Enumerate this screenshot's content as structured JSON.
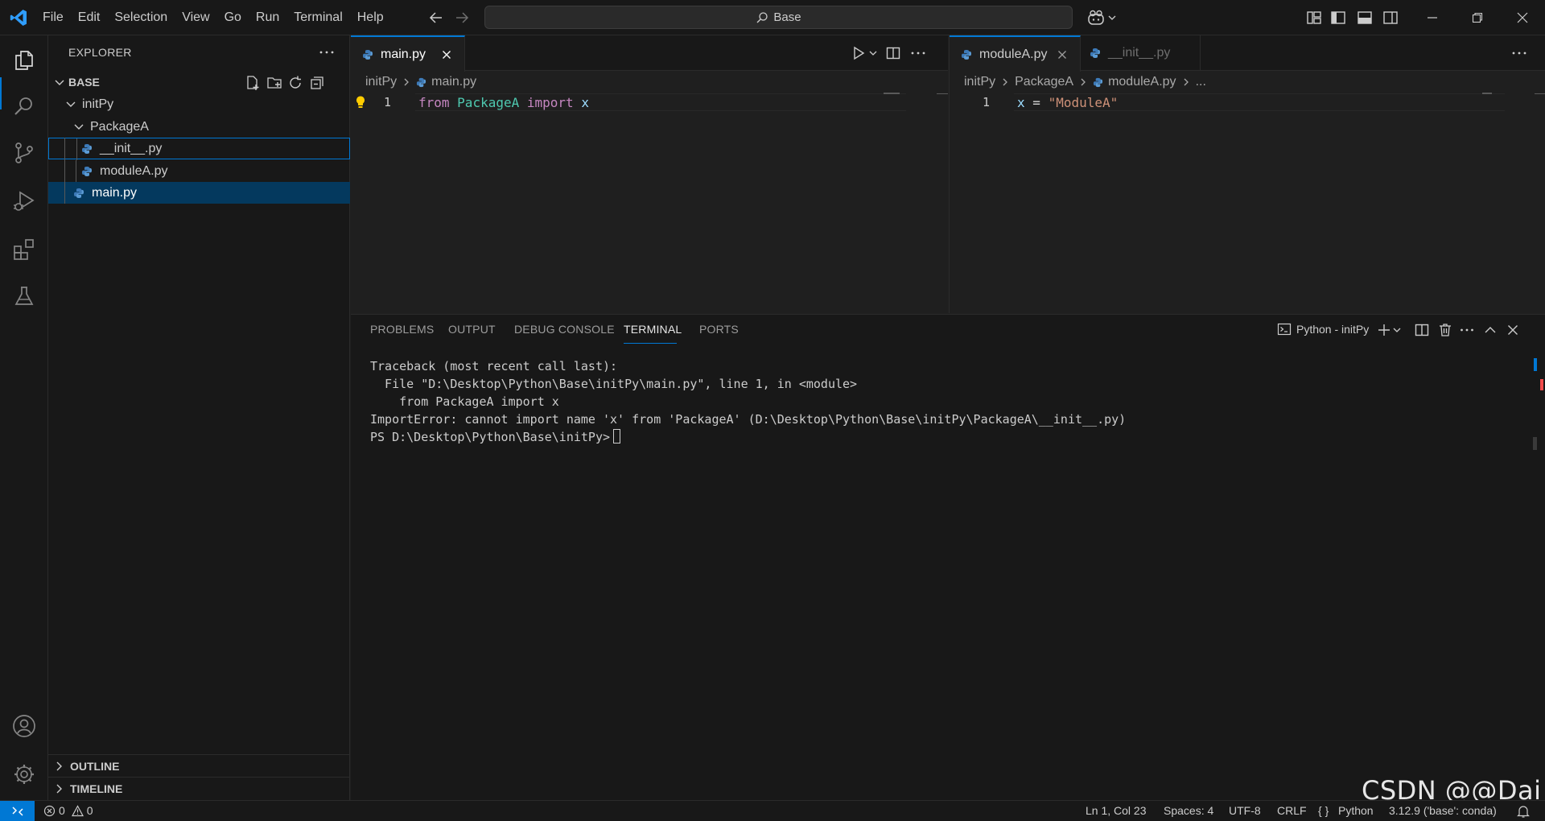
{
  "menu": [
    "File",
    "Edit",
    "Selection",
    "View",
    "Go",
    "Run",
    "Terminal",
    "Help"
  ],
  "search": {
    "text": "Base"
  },
  "sidebar": {
    "title": "EXPLORER",
    "root": "BASE",
    "tree": {
      "folder1": "initPy",
      "folder2": "PackageA",
      "file_init": "__init__.py",
      "file_moduleA": "moduleA.py",
      "file_main": "main.py"
    },
    "outline": "OUTLINE",
    "timeline": "TIMELINE"
  },
  "editor_left": {
    "tab": "main.py",
    "breadcrumbs": [
      "initPy",
      "main.py"
    ],
    "line_no": "1",
    "code": {
      "kw1": "from",
      "module": "PackageA",
      "kw2": "import",
      "name": "x"
    }
  },
  "editor_right": {
    "tabs": [
      "moduleA.py",
      "__init__.py"
    ],
    "breadcrumbs": [
      "initPy",
      "PackageA",
      "moduleA.py",
      "..."
    ],
    "line_no": "1",
    "code": {
      "var": "x",
      "op": "=",
      "str": "\"ModuleA\""
    }
  },
  "panel": {
    "tabs": [
      "PROBLEMS",
      "OUTPUT",
      "DEBUG CONSOLE",
      "TERMINAL",
      "PORTS"
    ],
    "active_tab": "TERMINAL",
    "profile": "Python - initPy",
    "terminal_lines": [
      "Traceback (most recent call last):",
      "  File \"D:\\Desktop\\Python\\Base\\initPy\\main.py\", line 1, in <module>",
      "    from PackageA import x",
      "ImportError: cannot import name 'x' from 'PackageA' (D:\\Desktop\\Python\\Base\\initPy\\PackageA\\__init__.py)"
    ],
    "prompt": "PS D:\\Desktop\\Python\\Base\\initPy>"
  },
  "status": {
    "errors": "0",
    "warnings": "0",
    "position": "Ln 1, Col 23",
    "spaces": "Spaces: 4",
    "encoding": "UTF-8",
    "eol": "CRLF",
    "language": "Python",
    "interpreter": "3.12.9 ('base': conda)"
  },
  "watermark": "CSDN @@Dai",
  "colors": {
    "accent": "#0078d4",
    "selection": "#04395e",
    "keyword": "#c586c0",
    "class": "#4ec9b0",
    "variable": "#9cdcfe",
    "string": "#ce9178",
    "python_icon": "#3d7ab8"
  }
}
